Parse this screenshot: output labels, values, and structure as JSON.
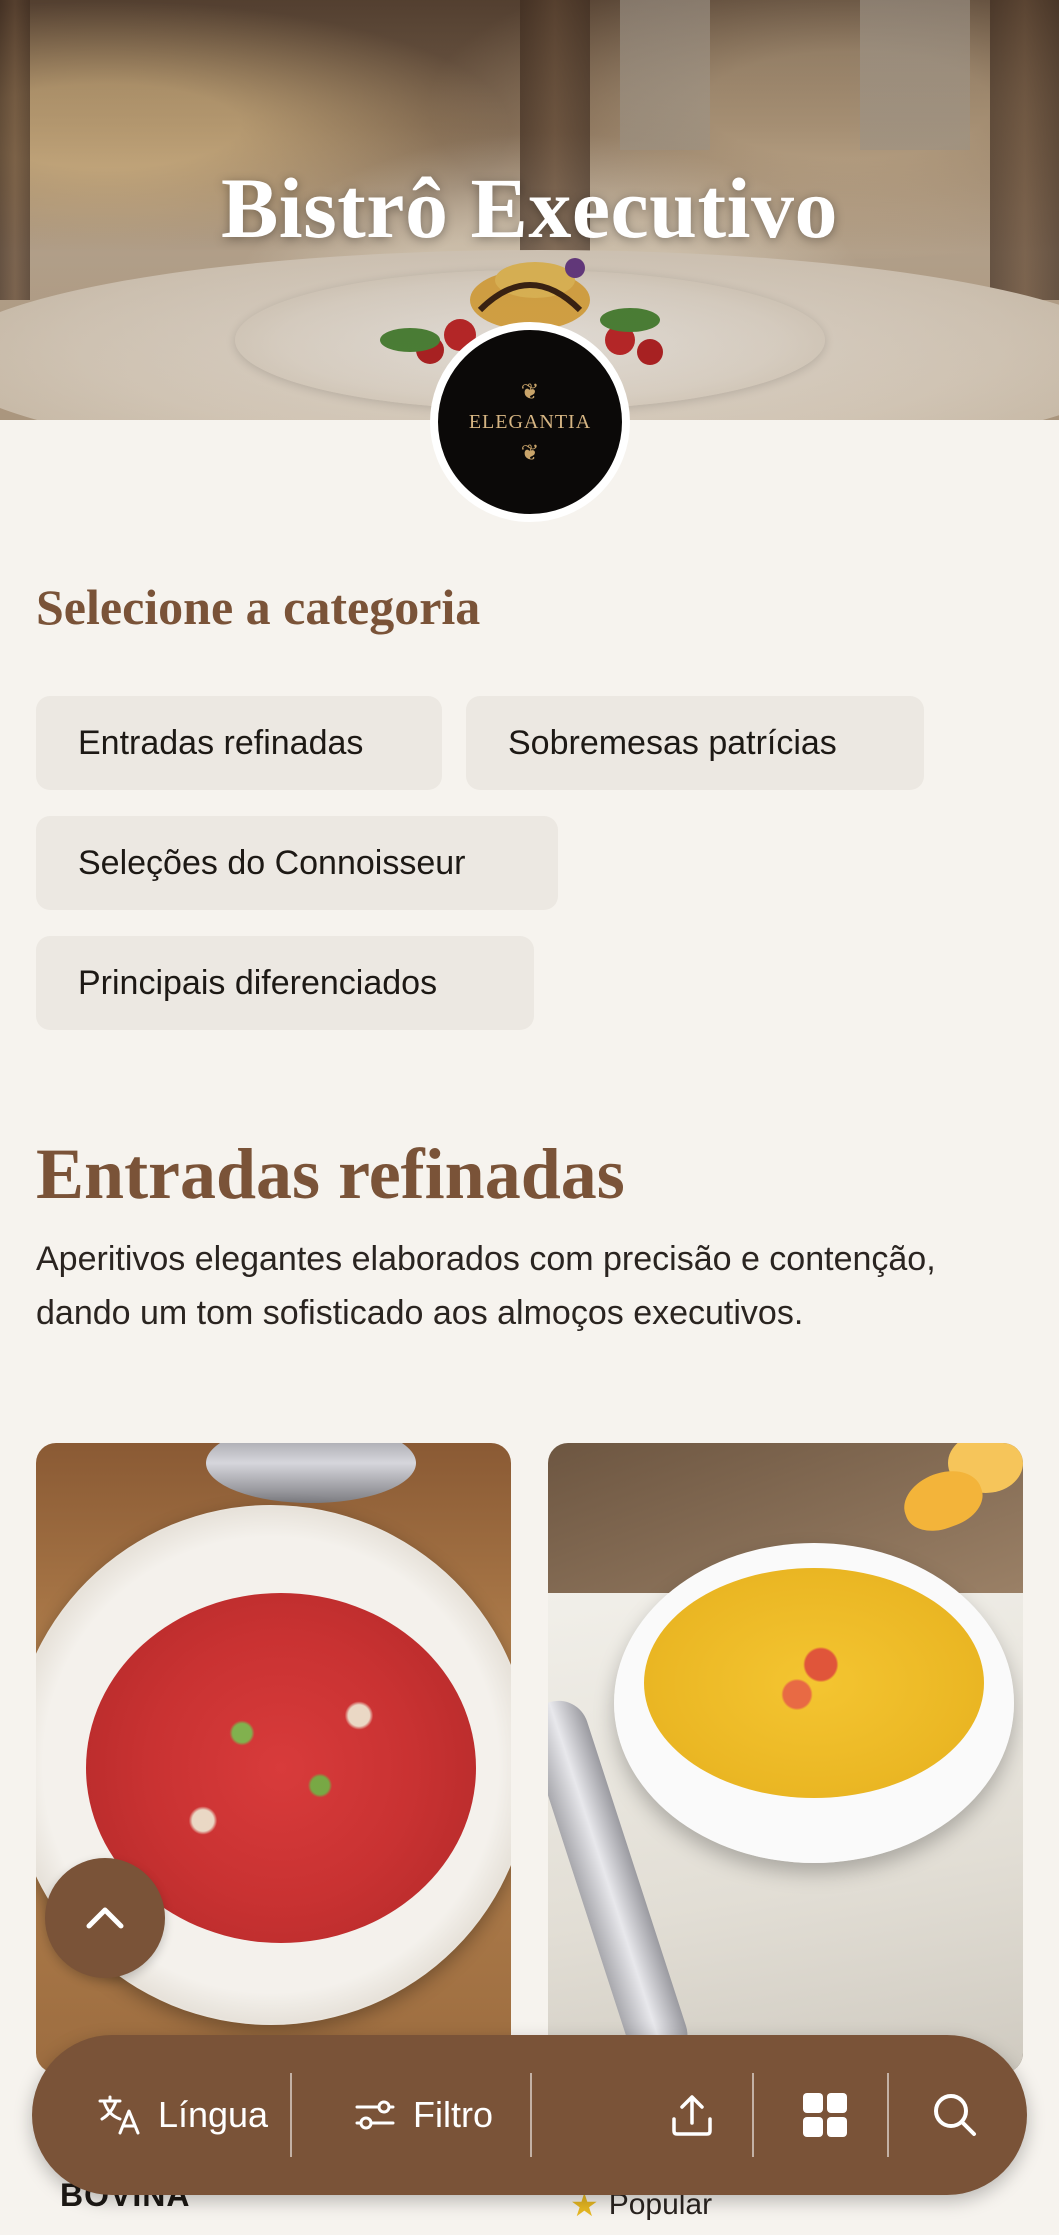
{
  "hero": {
    "title": "Bistrô Executivo"
  },
  "logo": {
    "brand": "ELEGANTIA"
  },
  "category_select": {
    "heading": "Selecione a categoria",
    "chips": [
      "Entradas refinadas",
      "Sobremesas patrícias",
      "Seleções do Connoisseur",
      "Principais diferenciados"
    ]
  },
  "section": {
    "title": "Entradas refinadas",
    "description": "Aperitivos elegantes elaborados com precisão e contenção, dando um tom sofisticado aos almoços executivos."
  },
  "cards": [
    {
      "label": "BOVINA",
      "icon": "carpaccio-image"
    },
    {
      "badge": "Popular",
      "icon": "soup-image"
    }
  ],
  "bottom_bar": {
    "language": "Língua",
    "filter": "Filtro",
    "accent_color": "#7a5338"
  }
}
